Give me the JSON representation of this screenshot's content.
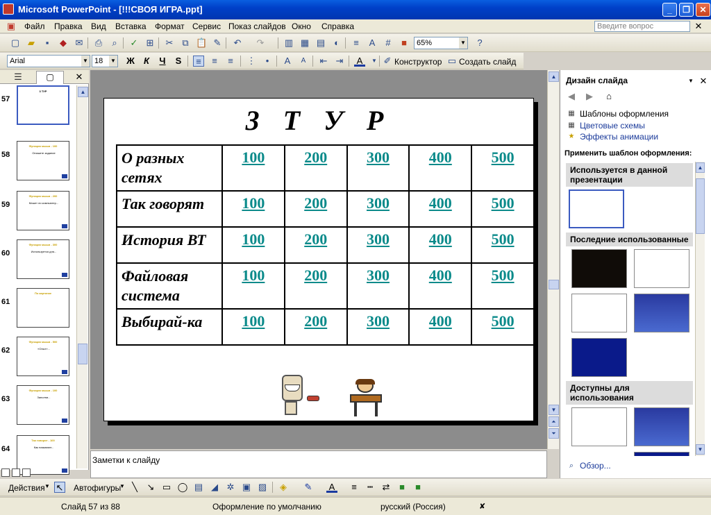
{
  "window": {
    "title": "Microsoft PowerPoint - [!!!СВОЯ ИГРА.ppt]"
  },
  "menu": {
    "items": [
      "Файл",
      "Правка",
      "Вид",
      "Вставка",
      "Формат",
      "Сервис",
      "Показ слайдов",
      "Окно",
      "Справка"
    ],
    "ask_placeholder": "Введите вопрос"
  },
  "toolbar": {
    "zoom": "65%"
  },
  "formatting": {
    "font": "Arial",
    "size": "18",
    "bold": "Ж",
    "italic": "К",
    "underline": "Ч",
    "shadow": "S",
    "designer": "Конструктор",
    "new_slide": "Создать слайд"
  },
  "thumbnails": [
    {
      "num": "57",
      "title": "3 ТУР",
      "text": ""
    },
    {
      "num": "58",
      "title": "Функция мыши - 100",
      "text": "Опишите задание"
    },
    {
      "num": "59",
      "title": "Функция мыши - 200",
      "text": "Может ли компьютер..."
    },
    {
      "num": "60",
      "title": "Функция мыши - 300",
      "text": "Используется для..."
    },
    {
      "num": "61",
      "title": "По картинке",
      "text": ""
    },
    {
      "num": "62",
      "title": "Функция мыши - 500",
      "text": "«Опыт»..."
    },
    {
      "num": "63",
      "title": "Функция мыши - 100",
      "text": "Заполни..."
    },
    {
      "num": "64",
      "title": "Так говорят - 100",
      "text": "Как называют..."
    }
  ],
  "slide": {
    "title": "3   Т У Р",
    "rows": [
      {
        "category": "О разных сетях",
        "values": [
          "100",
          "200",
          "300",
          "400",
          "500"
        ]
      },
      {
        "category": "Так говорят",
        "values": [
          "100",
          "200",
          "300",
          "400",
          "500"
        ]
      },
      {
        "category": "История ВТ",
        "values": [
          "100",
          "200",
          "300",
          "400",
          "500"
        ]
      },
      {
        "category": "Файловая система",
        "values": [
          "100",
          "200",
          "300",
          "400",
          "500"
        ]
      },
      {
        "category": "Выбирай-ка",
        "values": [
          "100",
          "200",
          "300",
          "400",
          "500"
        ]
      }
    ]
  },
  "notes": {
    "placeholder": "Заметки к слайду"
  },
  "taskpane": {
    "title": "Дизайн слайда",
    "links": [
      "Шаблоны оформления",
      "Цветовые схемы",
      "Эффекты анимации"
    ],
    "apply_label": "Применить шаблон оформления:",
    "section_used": "Используется в данной презентации",
    "section_recent": "Последние использованные",
    "section_available": "Доступны для использования",
    "browse": "Обзор..."
  },
  "drawbar": {
    "actions": "Действия",
    "autoshapes": "Автофигуры"
  },
  "status": {
    "slide": "Слайд 57 из 88",
    "design": "Оформление по умолчанию",
    "language": "русский (Россия)"
  }
}
